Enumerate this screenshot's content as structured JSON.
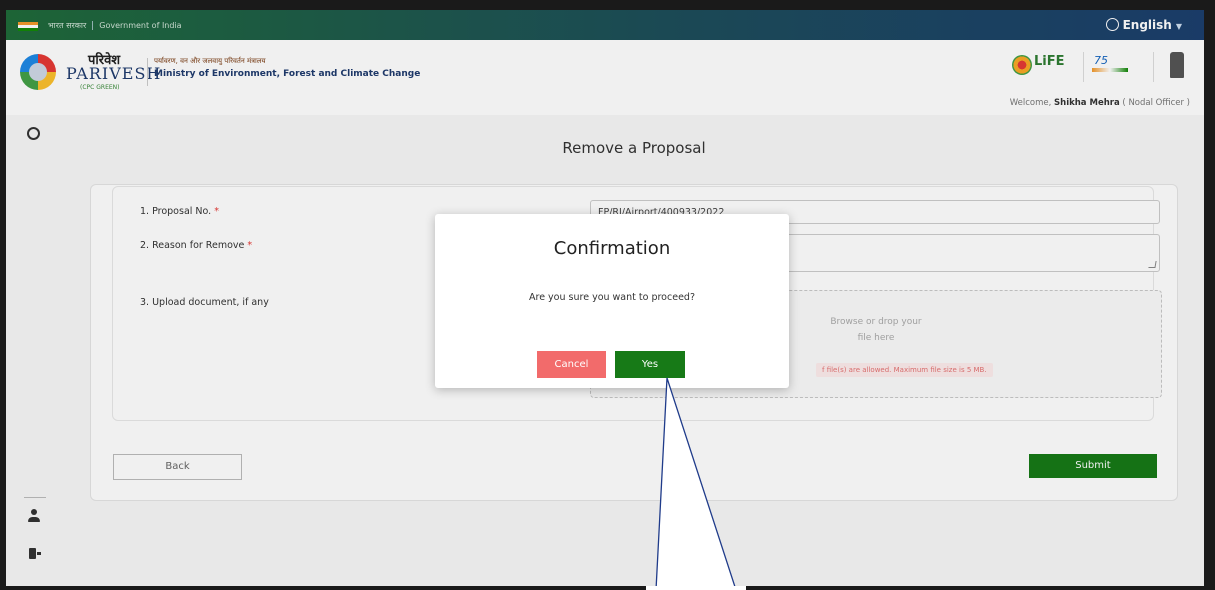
{
  "gov_bar": {
    "hindi_label": "भारत सरकार",
    "english_label": "Government of India",
    "language": "English"
  },
  "header": {
    "brand_hindi": "परिवेश",
    "brand_english": "PARIVESH",
    "brand_sub": "(CPC GREEN)",
    "ministry_hindi": "पर्यावरण, वन और जलवायु परिवर्तन मंत्रालय",
    "ministry_english": "Ministry of Environment, Forest and Climate Change",
    "life_logo_text": "LiFE",
    "azadi_logo_text": "75",
    "welcome_prefix": "Welcome,",
    "user_name": "Shikha Mehra",
    "user_role": "( Nodal Officer )"
  },
  "page": {
    "title": "Remove a Proposal"
  },
  "form": {
    "proposal_no_label": "1. Proposal No.",
    "proposal_no_value": "FP/RJ/Airport/400933/2022",
    "reason_label": "2. Reason for Remove",
    "upload_label": "3. Upload document, if any",
    "required_mark": "*",
    "dropzone_line1": "Browse or drop your",
    "dropzone_line2": "file here",
    "dropzone_error": "f file(s) are allowed. Maximum file size is 5 MB.",
    "back_label": "Back",
    "submit_label": "Submit"
  },
  "modal": {
    "title": "Confirmation",
    "message": "Are you sure you want to proceed?",
    "cancel_label": "Cancel",
    "yes_label": "Yes"
  },
  "colors": {
    "primary_green": "#177a17",
    "cancel_red": "#f26b6b",
    "callout_line": "#1f3b8a"
  }
}
